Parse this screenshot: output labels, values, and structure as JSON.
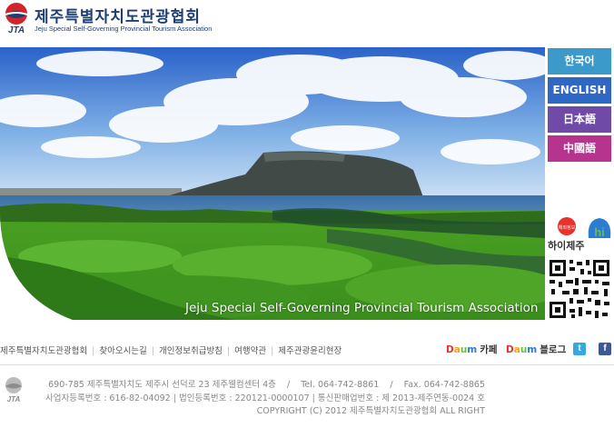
{
  "header": {
    "logo_acronym": "JTA",
    "title": "제주특별자치도관광협회",
    "subtitle": "Jeju Special Self-Governing Provincial Tourism Association"
  },
  "hero": {
    "caption": "Jeju Special Self-Governing Provincial Tourism Association"
  },
  "languages": [
    {
      "label": "한국어",
      "color": "#3b9ac9"
    },
    {
      "label": "ENGLISH",
      "color": "#2e67c4"
    },
    {
      "label": "日本語",
      "color": "#6f4ba7"
    },
    {
      "label": "中國語",
      "color": "#b6338e"
    }
  ],
  "hijeju": {
    "label": "하이제주",
    "bubble": "해외정보 탐방! 하이제주",
    "mark": "hi"
  },
  "footer_nav": [
    "제주특별자치도관광협회",
    "찾아오시는길",
    "개인정보취급방침",
    "여행약관",
    "제주관광윤리현장"
  ],
  "external_links": {
    "daum_brand": "Daum",
    "daum_cafe": "카페",
    "daum_blog": "블로그",
    "twitter_icon": "twitter-icon",
    "facebook_icon": "facebook-icon"
  },
  "footer_info": {
    "logo_acronym": "JTA",
    "address_line": "690-785 제주특별자치도 제주시 선덕로 23 제주웰컴센터 4층    /    Tel. 064-742-8861    /    Fax. 064-742-8865",
    "registration_line": "사업자등록번호 : 616-82-04092 | 법인등록번호 : 220121-0000107 | 통신판매업번호 : 제 2013-제주연동-0024 호",
    "copyright": "COPYRIGHT (C) 2012 제주특별자치도관광협회 ALL RIGHT"
  },
  "colors": {
    "brand_navy": "#1e3f73",
    "brand_red": "#d3232b"
  }
}
